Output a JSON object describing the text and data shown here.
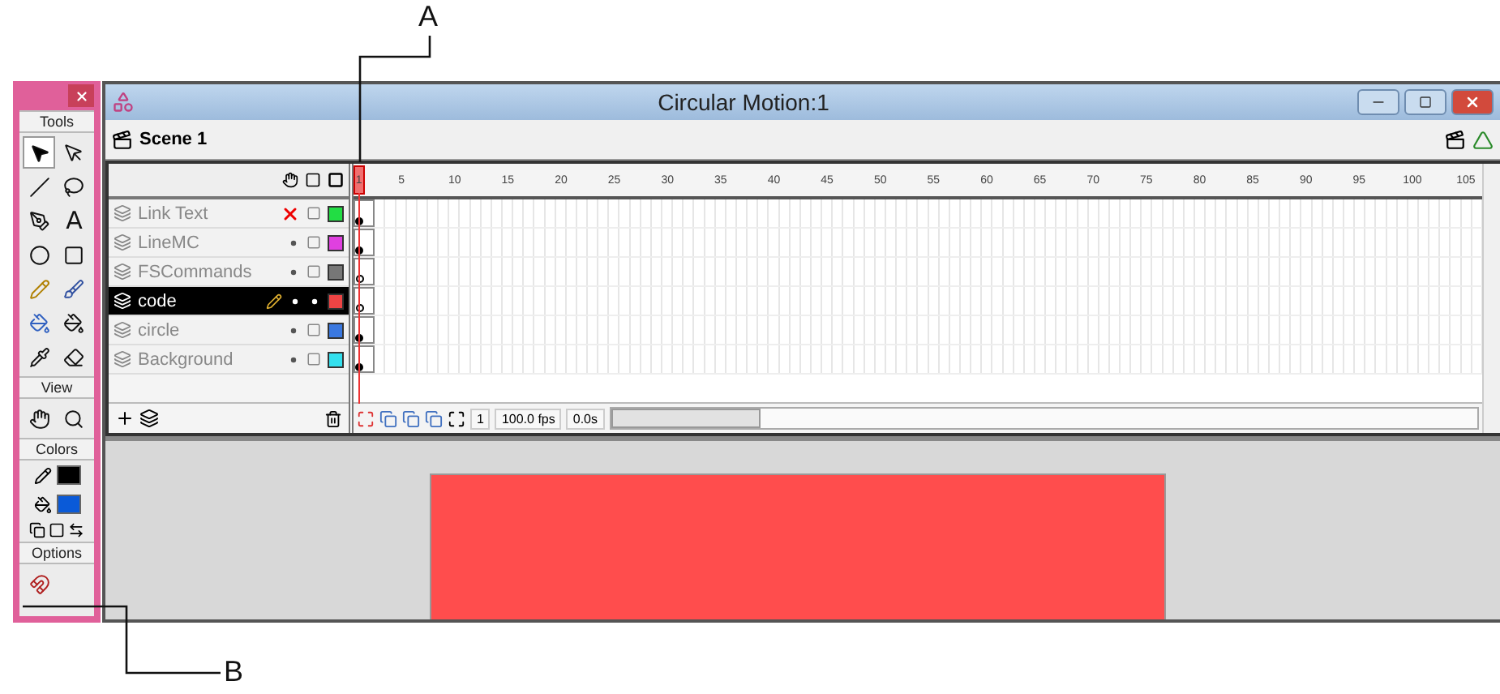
{
  "callouts": [
    {
      "label": "A"
    },
    {
      "label": "B"
    }
  ],
  "toolbox": {
    "sections": [
      {
        "title": "Tools",
        "tools": [
          {
            "kind": "arrow",
            "selected": true
          },
          {
            "kind": "subselect",
            "selected": false
          },
          {
            "kind": "line",
            "selected": false
          },
          {
            "kind": "lasso",
            "selected": false
          },
          {
            "kind": "pen",
            "selected": false
          },
          {
            "kind": "text",
            "glyph": "A",
            "selected": false
          },
          {
            "kind": "oval",
            "selected": false
          },
          {
            "kind": "rectangle",
            "selected": false
          },
          {
            "kind": "pencil",
            "selected": false
          },
          {
            "kind": "brush",
            "selected": false
          },
          {
            "kind": "ink",
            "selected": false
          },
          {
            "kind": "bucket",
            "selected": false
          },
          {
            "kind": "dropper",
            "selected": false
          },
          {
            "kind": "eraser",
            "selected": false
          }
        ]
      },
      {
        "title": "View",
        "tools": [
          {
            "kind": "hand",
            "selected": false
          },
          {
            "kind": "zoom",
            "selected": false
          }
        ]
      },
      {
        "title": "Colors",
        "swatches": [
          {
            "kind": "stroke",
            "color": "#000000"
          },
          {
            "kind": "fill",
            "color": "#0a5ad8"
          }
        ]
      },
      {
        "title": "Options",
        "tools": [
          {
            "kind": "magnet",
            "selected": false
          }
        ]
      }
    ]
  },
  "window": {
    "title": "Circular Motion:1",
    "scene": "Scene 1"
  },
  "timeline": {
    "frame_labels": [
      "1",
      "5",
      "10",
      "15",
      "20",
      "25",
      "30",
      "35",
      "40",
      "45",
      "50",
      "55",
      "60",
      "65",
      "70",
      "75",
      "80",
      "85",
      "90",
      "95",
      "100",
      "105"
    ],
    "layers": [
      {
        "name": "Link Text",
        "kind": "plain",
        "selected": false,
        "hidden": true,
        "editing": false,
        "color": "#22dd44"
      },
      {
        "name": "LineMC",
        "kind": "plain",
        "selected": false,
        "hidden": false,
        "editing": false,
        "color": "#e040e0"
      },
      {
        "name": "FSCommands",
        "kind": "action",
        "selected": false,
        "hidden": false,
        "editing": false,
        "color": "#777777"
      },
      {
        "name": "code",
        "kind": "action",
        "selected": true,
        "hidden": false,
        "editing": true,
        "color": "#ee4444"
      },
      {
        "name": "circle",
        "kind": "plain",
        "selected": false,
        "hidden": false,
        "editing": false,
        "color": "#3a78e0"
      },
      {
        "name": "Background",
        "kind": "plain",
        "selected": false,
        "hidden": false,
        "editing": false,
        "color": "#33e0ee"
      }
    ],
    "current_frame": "1",
    "frame_rate": "100.0 fps",
    "elapsed": "0.0s"
  },
  "stage": {
    "color": "#ff4d4d"
  }
}
